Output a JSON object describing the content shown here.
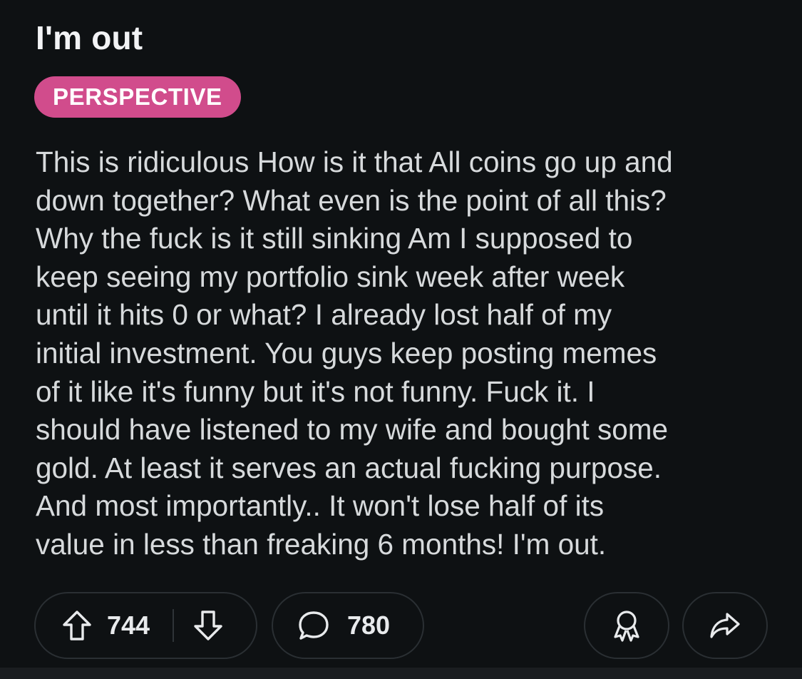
{
  "post": {
    "title": "I'm out",
    "flair": "PERSPECTIVE",
    "body": "This is ridiculous How is it that All coins go up and\ndown together? What even is the point of all this?\nWhy the fuck is it still sinking Am I supposed to\nkeep seeing my portfolio sink week after week\nuntil it hits 0 or what? I already lost half of my\ninitial investment. You guys keep posting memes\nof it like it's funny but it's not funny. Fuck it. I\nshould have listened to my wife and bought some\ngold. At least it serves an actual fucking purpose.\nAnd most importantly.. It won't lose half of its\nvalue in less than freaking 6 months! I'm out."
  },
  "actions": {
    "upvotes": "744",
    "comments": "780",
    "icons": {
      "upvote": "upvote-arrow-icon",
      "downvote": "downvote-arrow-icon",
      "comment": "comment-bubble-icon",
      "award": "award-ribbon-icon",
      "share": "share-arrow-icon"
    }
  },
  "colors": {
    "background": "#0e1113",
    "flair_background": "#d14c8c",
    "text": "#d7dadc",
    "pill_border": "#2a2f33"
  }
}
